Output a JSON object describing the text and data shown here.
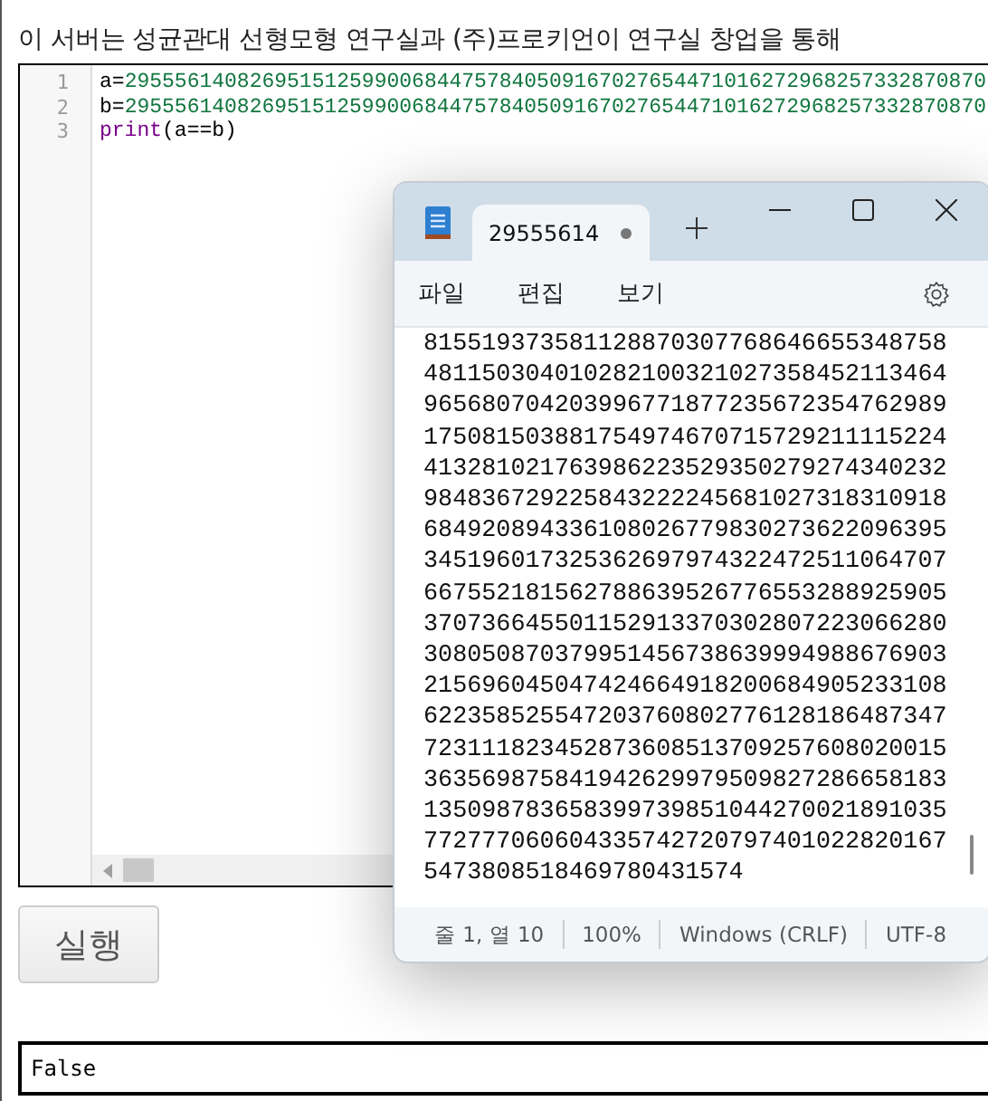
{
  "heading": "이 서버는 성균관대 선형모형 연구실과 (주)프로키언이 연구실 창업을 통해",
  "editor": {
    "lines": [
      {
        "number": "1",
        "tokens": [
          {
            "kind": "plain",
            "text": "a="
          },
          {
            "kind": "number",
            "text": "295556140826951512599006844757840509167027654471016272968257332870870"
          }
        ]
      },
      {
        "number": "2",
        "tokens": [
          {
            "kind": "plain",
            "text": "b="
          },
          {
            "kind": "number",
            "text": "295556140826951512599006844757840509167027654471016272968257332870870"
          }
        ]
      },
      {
        "number": "3",
        "tokens": [
          {
            "kind": "keyword",
            "text": "print"
          },
          {
            "kind": "plain",
            "text": "(a==b)"
          }
        ]
      }
    ]
  },
  "run_button": "실행",
  "output": "False",
  "notepad": {
    "tab_title": "29555614",
    "tab_unsaved": true,
    "menu": [
      "파일",
      "편집",
      "보기"
    ],
    "text_lines": [
      "815519373581128870307768646655348758",
      "481150304010282100321027358452113464",
      "965680704203996771877235672354762989",
      "175081503881754974670715729211115224",
      "413281021763986223529350279274340232",
      "984836729225843222245681027318310918",
      "684920894336108026779830273622096395",
      "345196017325362697974322472511064707",
      "667552181562788639526776553288925905",
      "370736645501152913370302807223066280",
      "308050870379951456738639994988676903",
      "215696045047424664918200684905233108",
      "622358525547203760802776128186487347",
      "723111823452873608513709257608020015",
      "363569875841942629979509827286658183",
      "135098783658399739851044270021891035",
      "772777060604335742720797401022820167",
      "5473808518469780431574"
    ],
    "status": [
      "줄 1, 열 10",
      "100%",
      "Windows (CRLF)",
      "UTF-8"
    ]
  }
}
